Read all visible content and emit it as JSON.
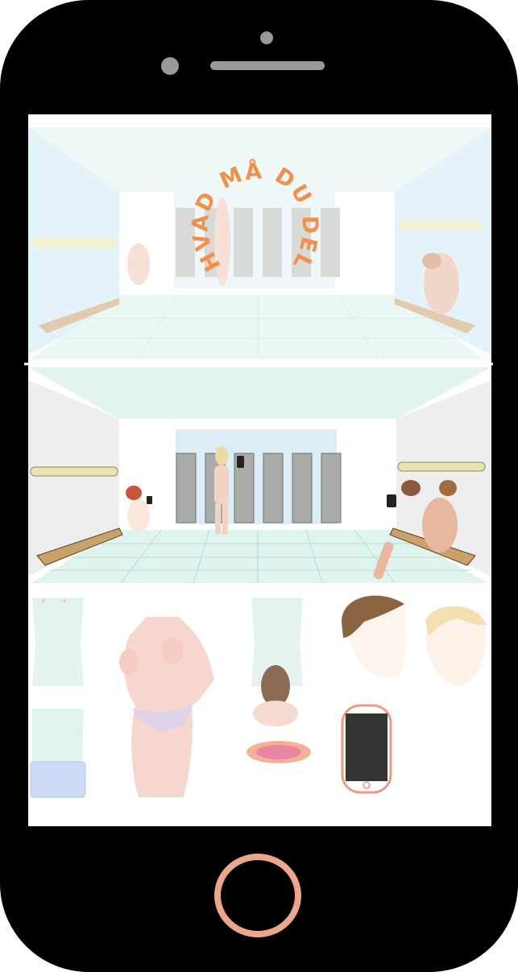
{
  "title": {
    "text": "HVAD MÅ DU DELE?",
    "color": "#f2904a"
  },
  "colors": {
    "phone_body": "#000000",
    "screen": "#ffffff",
    "home_ring": "#eaa78a",
    "camera": "#999999",
    "floor_tile": "#dff3ef",
    "locker": "#a9aba9",
    "bench": "#c9a26a",
    "skin": "#f2c7b6",
    "hair_brown": "#8a5a3c",
    "hair_blonde": "#f0d9a0"
  },
  "icons": {
    "home_button": "home-button-ring",
    "camera": "front-camera-dot",
    "speaker": "speaker-slot",
    "phone": "smartphone-icon"
  }
}
